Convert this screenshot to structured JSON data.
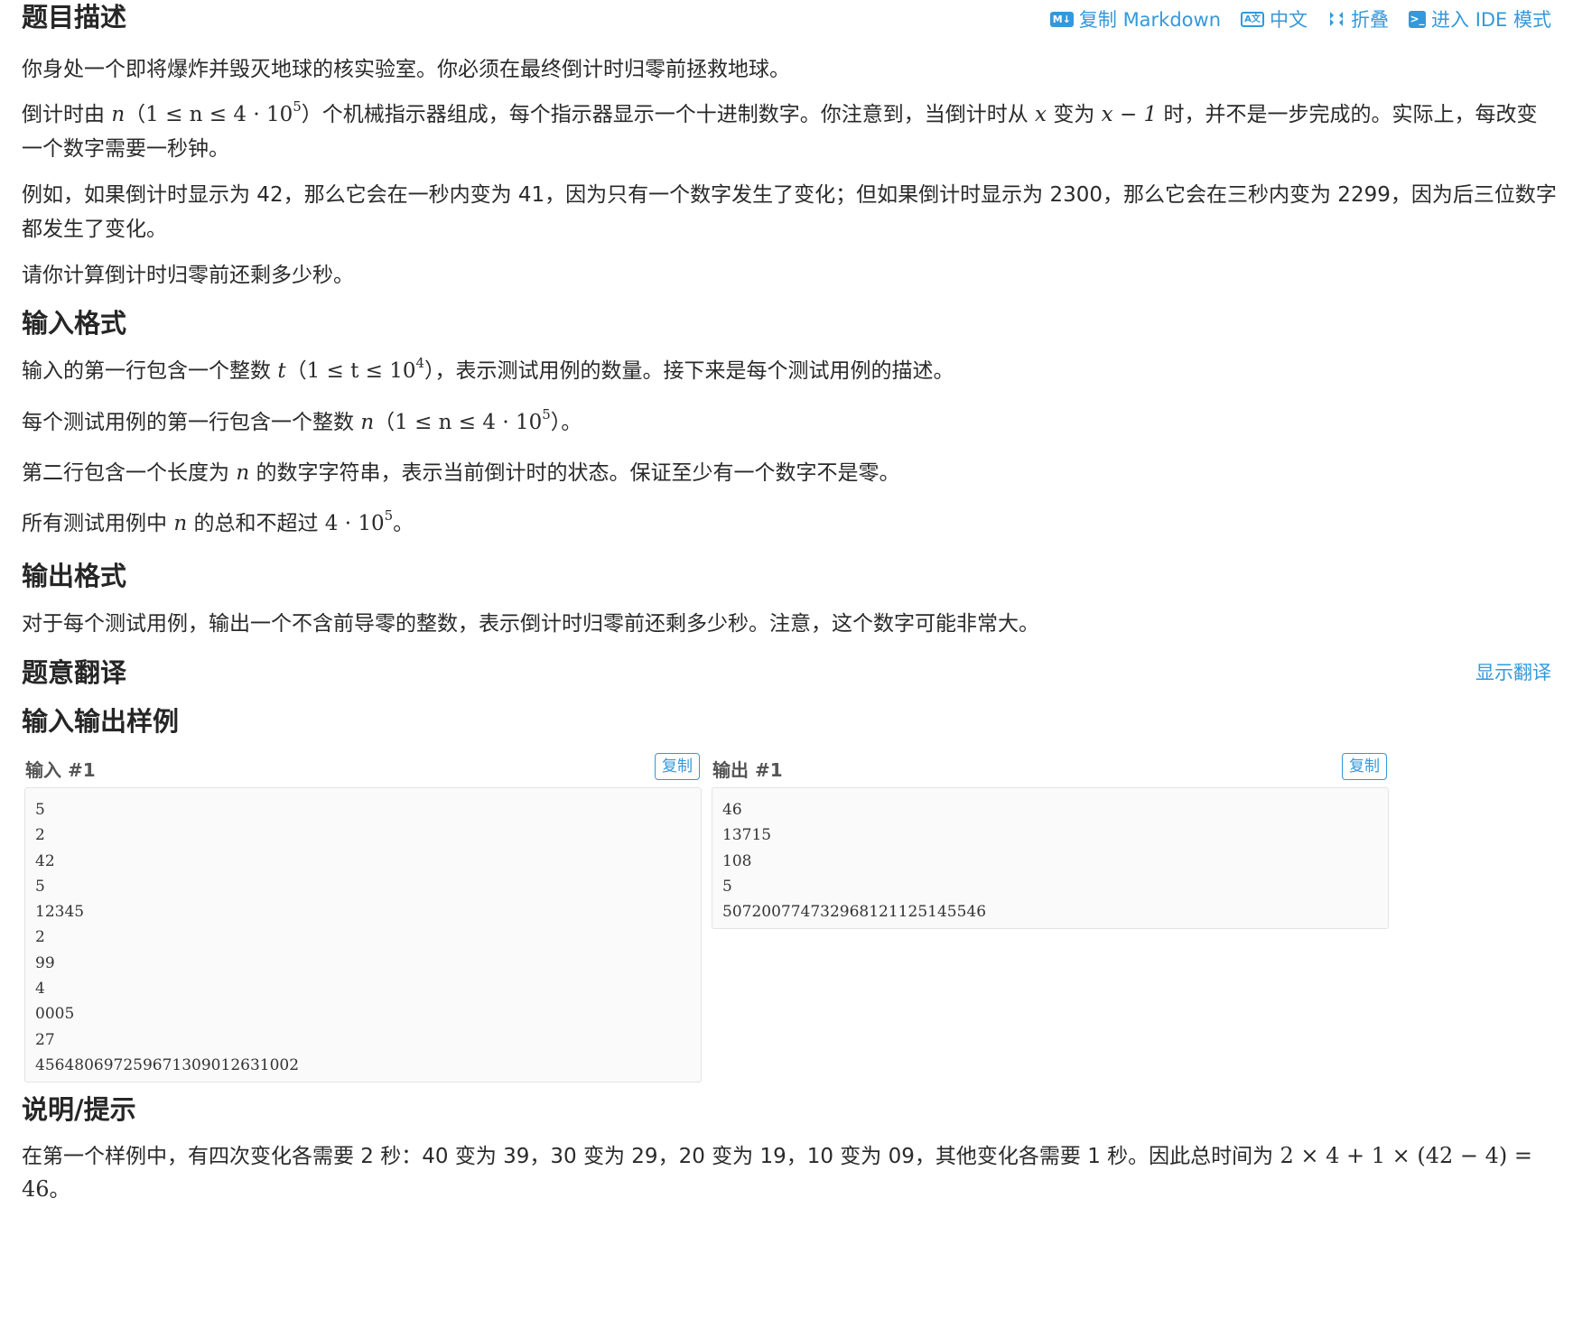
{
  "toolbar": {
    "copy_markdown": "复制 Markdown",
    "md_icon_text": "M↓",
    "language": "中文",
    "lang_icon_text": "A文",
    "fold": "折叠",
    "ide": "进入 IDE 模式",
    "ide_icon_text": ">_"
  },
  "description": {
    "heading": "题目描述",
    "p1": "你身处一个即将爆炸并毁灭地球的核实验室。你必须在最终倒计时归零前拯救地球。",
    "p2": {
      "a": "倒计时由 ",
      "n": "n",
      "cond_open": "（",
      "cond": "1 ≤ n ≤ 4 · 10",
      "exp": "5",
      "cond_close": "）",
      "b": "个机械指示器组成，每个指示器显示一个十进制数字。你注意到，当倒计时从 ",
      "x": "x",
      "c": " 变为 ",
      "x1": "x − 1",
      "d": " 时，并不是一步完成的。实际上，每改变一个数字需要一秒钟。"
    },
    "p3": "例如，如果倒计时显示为 42，那么它会在一秒内变为 41，因为只有一个数字发生了变化；但如果倒计时显示为 2300，那么它会在三秒内变为 2299，因为后三位数字都发生了变化。",
    "p4": "请你计算倒计时归零前还剩多少秒。"
  },
  "input_format": {
    "heading": "输入格式",
    "p1": {
      "a": "输入的第一行包含一个整数 ",
      "t": "t",
      "open": "（",
      "cond": "1 ≤ t ≤ 10",
      "exp": "4",
      "close": "），",
      "b": "表示测试用例的数量。接下来是每个测试用例的描述。"
    },
    "p2": {
      "a": "每个测试用例的第一行包含一个整数 ",
      "n": "n",
      "open": "（",
      "cond": "1 ≤ n ≤ 4 · 10",
      "exp": "5",
      "close": "）。"
    },
    "p3": {
      "a": "第二行包含一个长度为 ",
      "n": "n",
      "b": " 的数字字符串，表示当前倒计时的状态。保证至少有一个数字不是零。"
    },
    "p4": {
      "a": "所有测试用例中 ",
      "n": "n",
      "b": " 的总和不超过 ",
      "val": "4 · 10",
      "exp": "5",
      "c": "。"
    }
  },
  "output_format": {
    "heading": "输出格式",
    "p1": "对于每个测试用例，输出一个不含前导零的整数，表示倒计时归零前还剩多少秒。注意，这个数字可能非常大。"
  },
  "translation": {
    "heading": "题意翻译",
    "show_link": "显示翻译"
  },
  "samples": {
    "heading": "输入输出样例",
    "input_label": "输入 #1",
    "output_label": "输出 #1",
    "copy_label": "复制",
    "input_lines": [
      "5",
      "2",
      "42",
      "5",
      "12345",
      "2",
      "99",
      "4",
      "0005",
      "27",
      "456480697259671309012631002"
    ],
    "output_lines": [
      "46",
      "13715",
      "108",
      "5",
      "507200774732968121125145546"
    ]
  },
  "hint": {
    "heading": "说明/提示",
    "a": "在第一个样例中，有四次变化各需要 2 秒：40 变为 39，30 变为 29，20 变为 19，10 变为 09，其他变化各需要 1 秒。因此总时间为 ",
    "formula": "2 × 4 + 1 × (42 − 4) = 46",
    "b": "。"
  },
  "colors": {
    "link": "#3498db",
    "text": "#262626",
    "code_bg": "#fafafa"
  }
}
